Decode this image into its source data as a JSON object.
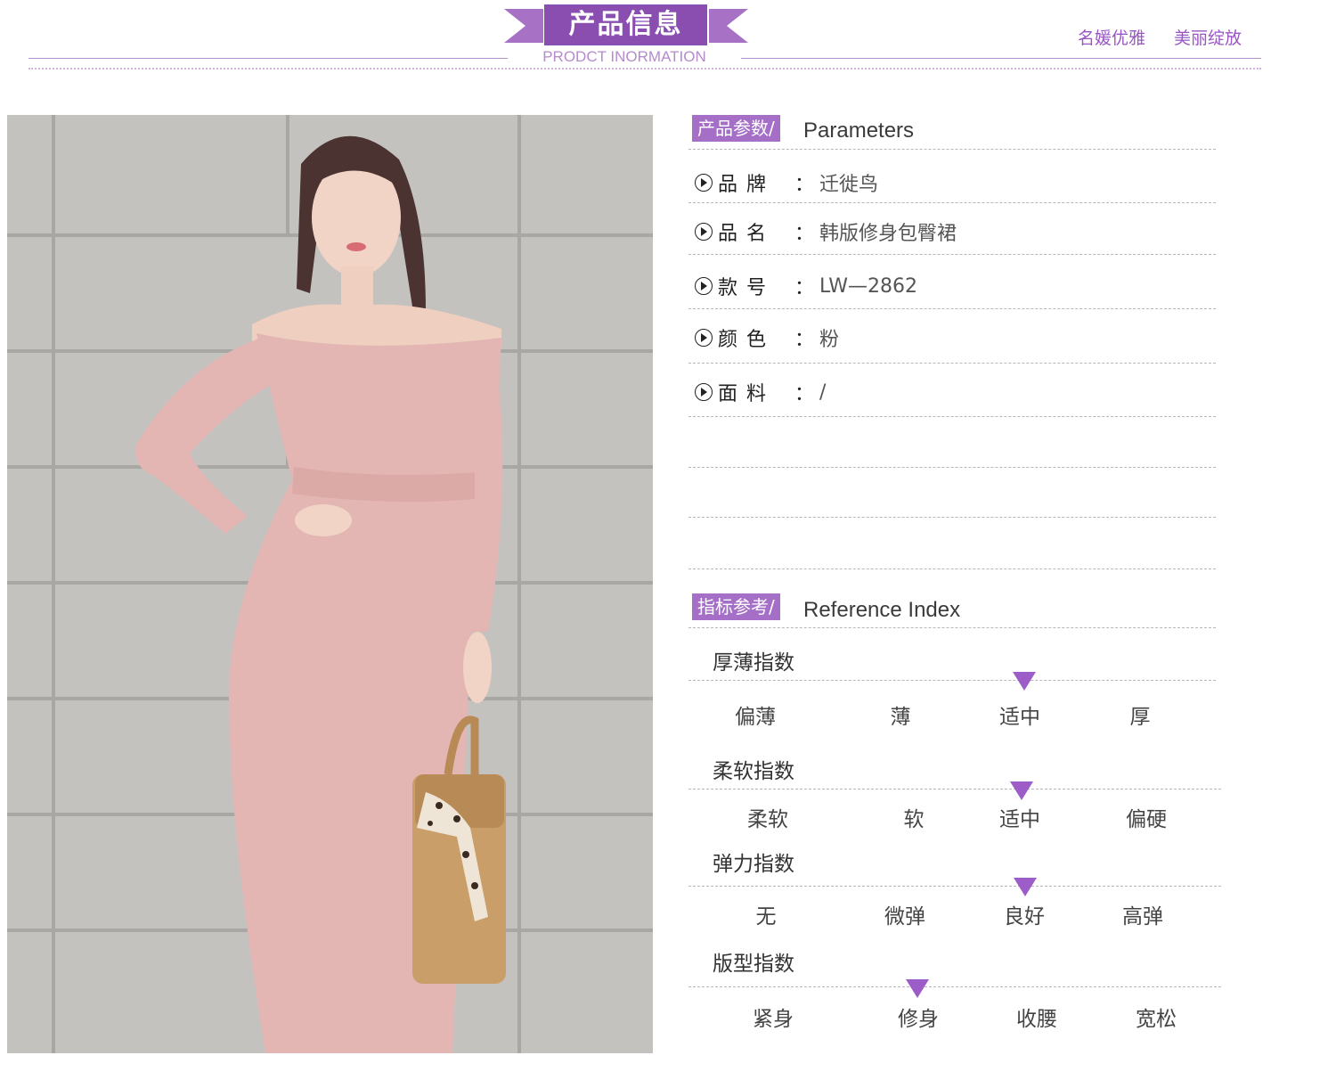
{
  "header": {
    "title": "产品信息",
    "subtitle": "PRODCT INORMATION",
    "slogans": [
      "名媛优雅",
      "美丽绽放"
    ]
  },
  "parameters": {
    "tag": "产品参数/",
    "heading": "Parameters",
    "rows": [
      {
        "label": "品牌",
        "colon": "：",
        "value": "迁徙鸟"
      },
      {
        "label": "品名",
        "colon": "：",
        "value": "韩版修身包臀裙"
      },
      {
        "label": "款号",
        "colon": "：",
        "value": "LW—2862"
      },
      {
        "label": "颜色",
        "colon": "：",
        "value": "粉"
      },
      {
        "label": "面料",
        "colon": "：",
        "value": "/"
      }
    ]
  },
  "reference": {
    "tag": "指标参考/",
    "heading": "Reference Index",
    "indices": [
      {
        "title": "厚薄指数",
        "options": [
          "偏薄",
          "薄",
          "适中",
          "厚"
        ],
        "selected": 2
      },
      {
        "title": "柔软指数",
        "options": [
          "柔软",
          "软",
          "适中",
          "偏硬"
        ],
        "selected": 2
      },
      {
        "title": "弹力指数",
        "options": [
          "无",
          "微弹",
          "良好",
          "高弹"
        ],
        "selected": 2
      },
      {
        "title": "版型指数",
        "options": [
          "紧身",
          "修身",
          "收腰",
          "宽松"
        ],
        "selected": 1
      }
    ]
  },
  "colors": {
    "accent": "#8a4db0",
    "tag_bg": "#a56fc8",
    "marker": "#9d5dc8",
    "dress": "#e6bcb8"
  }
}
